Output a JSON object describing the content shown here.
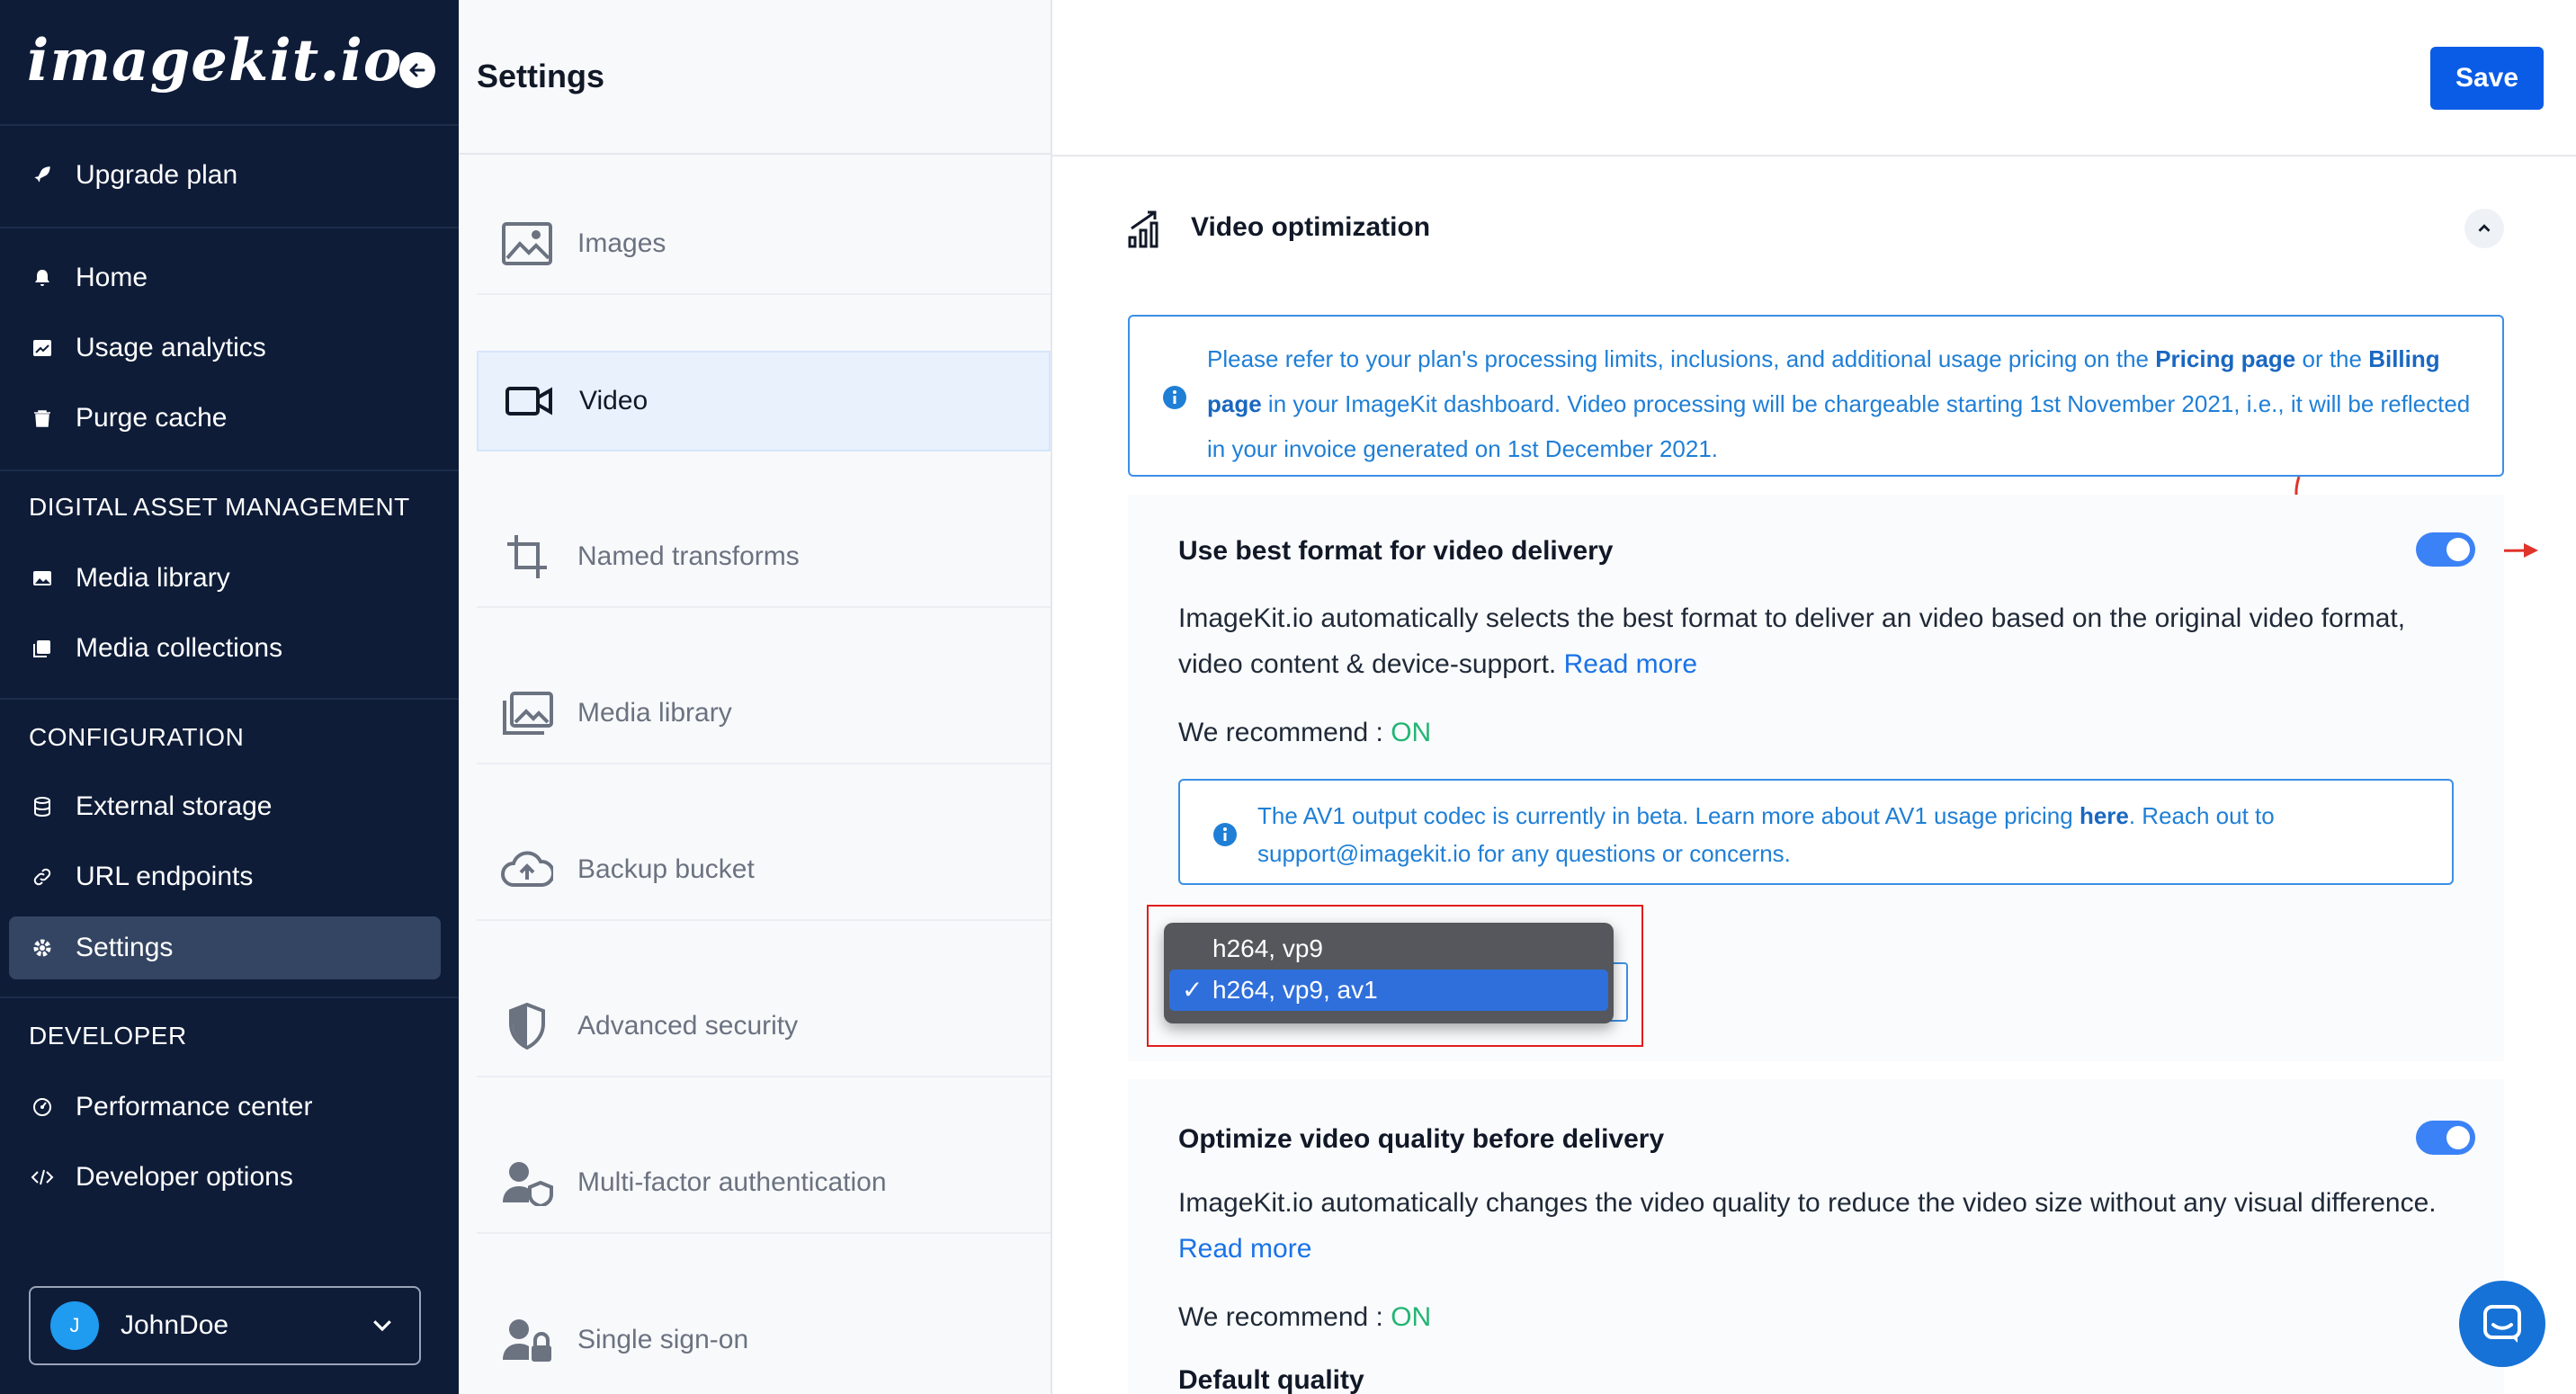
{
  "sidebar": {
    "logo": "imagekit.io",
    "items": [
      {
        "label": "Upgrade plan",
        "icon": "rocket-icon"
      },
      {
        "label": "Home",
        "icon": "bell-icon"
      },
      {
        "label": "Usage analytics",
        "icon": "chart-icon"
      },
      {
        "label": "Purge cache",
        "icon": "trash-icon"
      },
      {
        "label": "Media library",
        "icon": "image-icon"
      },
      {
        "label": "Media collections",
        "icon": "collection-icon"
      },
      {
        "label": "External storage",
        "icon": "database-icon"
      },
      {
        "label": "URL endpoints",
        "icon": "link-icon"
      },
      {
        "label": "Settings",
        "icon": "gear-icon",
        "active": true
      },
      {
        "label": "Performance center",
        "icon": "gauge-icon"
      },
      {
        "label": "Developer options",
        "icon": "code-icon"
      }
    ],
    "sections": [
      "DIGITAL ASSET MANAGEMENT",
      "CONFIGURATION",
      "DEVELOPER"
    ],
    "user": {
      "initial": "J",
      "name": "JohnDoe"
    }
  },
  "settings_nav": {
    "title": "Settings",
    "items": [
      {
        "label": "Images",
        "icon": "image-icon"
      },
      {
        "label": "Video",
        "icon": "video-icon",
        "active": true
      },
      {
        "label": "Named transforms",
        "icon": "crop-icon"
      },
      {
        "label": "Media library",
        "icon": "gallery-icon"
      },
      {
        "label": "Backup bucket",
        "icon": "cloud-upload-icon"
      },
      {
        "label": "Advanced security",
        "icon": "shield-icon"
      },
      {
        "label": "Multi-factor authentication",
        "icon": "user-shield-icon"
      },
      {
        "label": "Single sign-on",
        "icon": "user-lock-icon"
      }
    ]
  },
  "main": {
    "save_label": "Save",
    "section_title": "Video optimization",
    "info": {
      "t1": "Please refer to your plan's processing limits, inclusions, and additional usage pricing on the ",
      "link1": "Pricing page",
      "t2": " or the ",
      "link2": "Billing page",
      "t3": " in your ImageKit dashboard. Video processing will be chargeable starting 1st November 2021, i.e., it will be reflected in your invoice generated on 1st December 2021."
    },
    "format_card": {
      "title": "Use best format for video delivery",
      "desc": "ImageKit.io automatically selects the best format to deliver an video based on the original video format, video content & device-support. ",
      "read_more": "Read more",
      "rec_label": "We recommend : ",
      "rec_value": "ON",
      "beta_t1": "The AV1 output codec is currently in beta. Learn more about AV1 usage pricing ",
      "beta_link": "here",
      "beta_t2": ". Reach out to support@imagekit.io for any questions or concerns.",
      "codec_options": [
        "h264, vp9",
        "h264, vp9, av1"
      ],
      "codec_selected": "h264, vp9, av1",
      "enabled": true
    },
    "quality_card": {
      "title": "Optimize video quality before delivery",
      "desc": "ImageKit.io automatically changes the video quality to reduce the video size without any visual difference. ",
      "read_more": "Read more",
      "rec_label": "We recommend : ",
      "rec_value": "ON",
      "default_quality_label": "Default quality",
      "enabled": true
    }
  },
  "colors": {
    "sidebar_bg": "#0e1c38",
    "primary": "#0a5ce6",
    "on_green": "#22b573",
    "info_blue": "#1f7fd6"
  }
}
